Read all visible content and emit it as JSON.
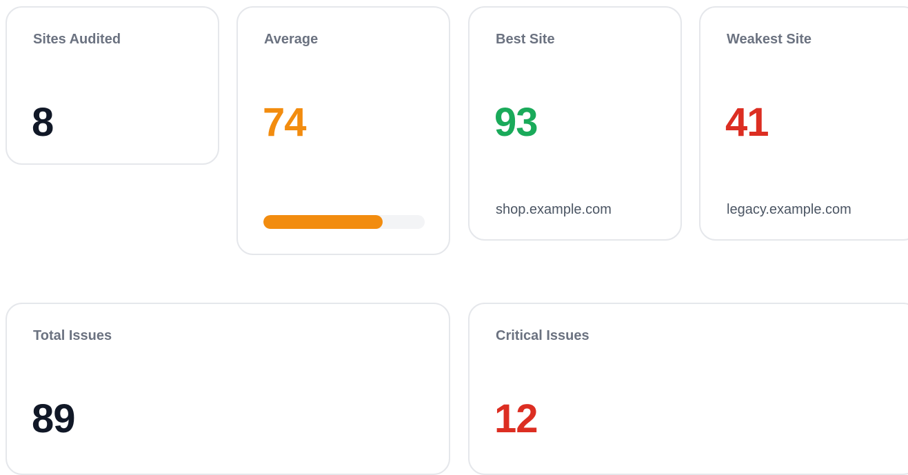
{
  "colors": {
    "neutral": "#111827",
    "warning": "#f28c0f",
    "success": "#1aaa5a",
    "danger": "#dc2e22"
  },
  "cards": {
    "sites_audited": {
      "label": "Sites Audited",
      "value": "8"
    },
    "average": {
      "label": "Average",
      "value": "74",
      "progress_percent": 74
    },
    "best_site": {
      "label": "Best Site",
      "value": "93",
      "site": "shop.example.com"
    },
    "weakest_site": {
      "label": "Weakest Site",
      "value": "41",
      "site": "legacy.example.com"
    },
    "total_issues": {
      "label": "Total Issues",
      "value": "89"
    },
    "critical_issues": {
      "label": "Critical Issues",
      "value": "12"
    }
  }
}
